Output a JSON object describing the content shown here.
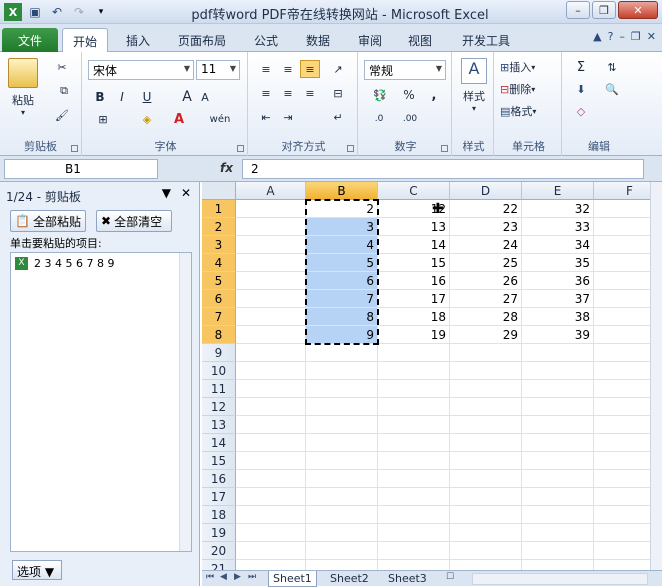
{
  "window": {
    "title": "pdf转word PDF帝在线转换网站 - Microsoft Excel",
    "minimize": "–",
    "restore": "❐",
    "close": "✕"
  },
  "tabs": [
    "文件",
    "开始",
    "插入",
    "页面布局",
    "公式",
    "数据",
    "审阅",
    "视图",
    "开发工具"
  ],
  "ribbon": {
    "clipboard": {
      "label": "剪贴板",
      "paste": "粘贴"
    },
    "font": {
      "label": "字体",
      "name": "宋体",
      "size": "11",
      "bold": "B",
      "italic": "I",
      "underline": "U",
      "grow": "A",
      "shrink": "A",
      "color_a": "A",
      "phonetic": "wén"
    },
    "align": {
      "label": "对齐方式"
    },
    "number": {
      "label": "数字",
      "format": "常规",
      "percent": "%",
      "comma": ",",
      "inc": ".0",
      "dec": ".00"
    },
    "styles": {
      "label": "样式",
      "btn": "样式"
    },
    "cells": {
      "label": "单元格",
      "insert": "插入",
      "delete": "删除",
      "format": "格式"
    },
    "editing": {
      "label": "编辑",
      "sum": "Σ"
    }
  },
  "formula": {
    "name": "B1",
    "fx": "fx",
    "value": "2"
  },
  "clipboard_pane": {
    "title": "1/24 - 剪贴板",
    "paste_all": "全部粘贴",
    "clear_all": "全部清空",
    "hint": "单击要粘贴的项目:",
    "item": "2 3 4 5 6 7 8 9",
    "options": "选项 ▼"
  },
  "grid": {
    "columns": [
      "A",
      "B",
      "C",
      "D",
      "E",
      "F"
    ],
    "rows": [
      "1",
      "2",
      "3",
      "4",
      "5",
      "6",
      "7",
      "8",
      "9",
      "10",
      "11",
      "12",
      "13",
      "14",
      "15",
      "16",
      "17",
      "18",
      "19",
      "20",
      "21"
    ],
    "data": [
      [
        "",
        "2",
        "12",
        "22",
        "32"
      ],
      [
        "",
        "3",
        "13",
        "23",
        "33"
      ],
      [
        "",
        "4",
        "14",
        "24",
        "34"
      ],
      [
        "",
        "5",
        "15",
        "25",
        "35"
      ],
      [
        "",
        "6",
        "16",
        "26",
        "36"
      ],
      [
        "",
        "7",
        "17",
        "27",
        "37"
      ],
      [
        "",
        "8",
        "18",
        "28",
        "38"
      ],
      [
        "",
        "9",
        "19",
        "29",
        "39"
      ]
    ]
  },
  "sheets": [
    "Sheet1",
    "Sheet2",
    "Sheet3"
  ]
}
